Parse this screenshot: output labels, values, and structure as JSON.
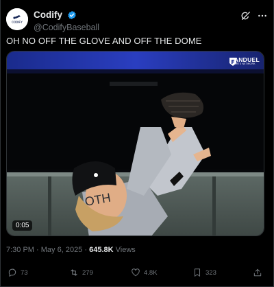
{
  "author": {
    "display_name": "Codify",
    "handle": "@CodifyBaseball",
    "avatar_text": "CODIFY",
    "verified_icon": "verified-badge-icon"
  },
  "tweet": {
    "text": "OH NO OFF THE GLOVE AND OFF THE DOME"
  },
  "media": {
    "broadcast_logo_main": "FANDUEL",
    "broadcast_logo_sub": "SPORTS NETWORK",
    "jersey_text": "OTH",
    "duration": "0:05"
  },
  "meta": {
    "time": "7:30 PM",
    "separator": "·",
    "date": "May 6, 2025",
    "views_count": "645.8K",
    "views_label": "Views"
  },
  "actions": {
    "replies": "73",
    "reposts": "279",
    "likes": "4.8K",
    "bookmarks": "323"
  },
  "colors": {
    "background": "#000000",
    "text_primary": "#e7e9ea",
    "text_secondary": "#71767b",
    "verified": "#1d9bf0",
    "border": "#2f3336"
  }
}
